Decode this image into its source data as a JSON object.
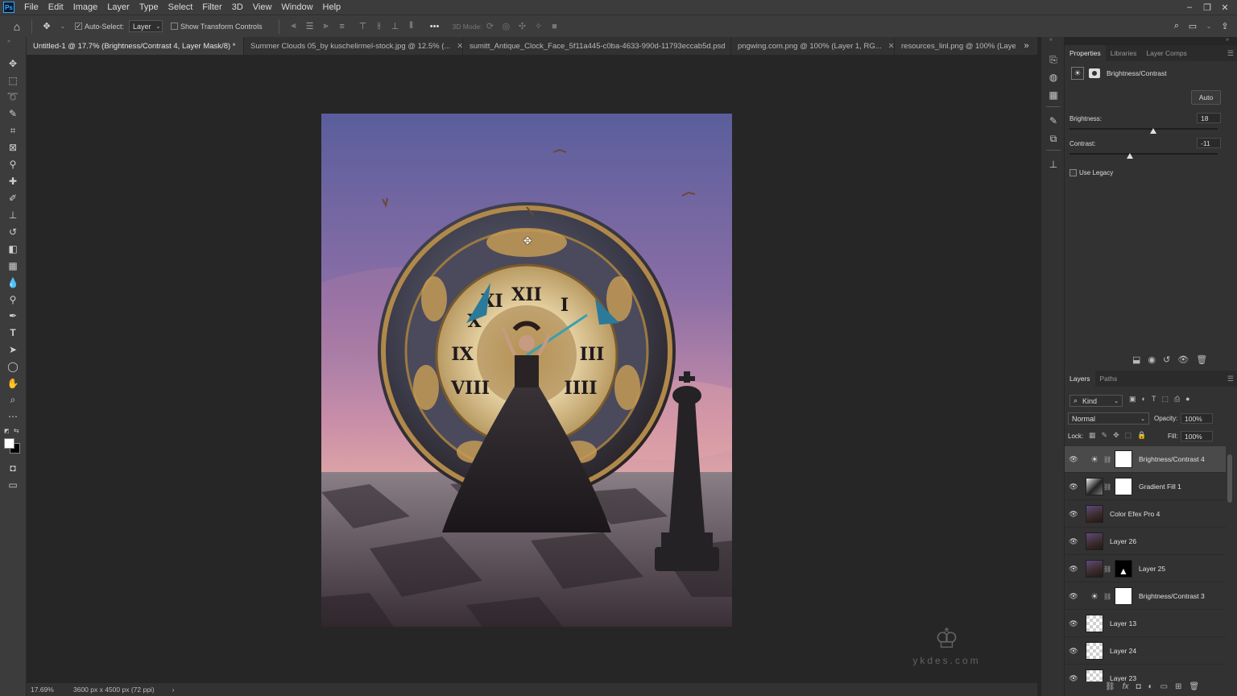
{
  "app": {
    "logo": "Ps"
  },
  "menu": [
    "File",
    "Edit",
    "Image",
    "Layer",
    "Type",
    "Select",
    "Filter",
    "3D",
    "View",
    "Window",
    "Help"
  ],
  "window_controls": {
    "minimize": "–",
    "restore": "❐",
    "close": "✕"
  },
  "options": {
    "auto_select_label": "Auto-Select:",
    "auto_select_value": "Layer",
    "show_transform_label": "Show Transform Controls",
    "three_d_mode": "3D Mode:",
    "more": "•••"
  },
  "tabs": [
    {
      "label": "Untitled-1 @ 17.7% (Brightness/Contrast 4, Layer Mask/8) *",
      "active": true
    },
    {
      "label": "Summer Clouds 05_by kuschelirmel-stock.jpg @ 12.5% (...",
      "active": false
    },
    {
      "label": "sumitt_Antique_Clock_Face_5f11a445-c0ba-4633-990d-11793eccab5d.psd",
      "active": false
    },
    {
      "label": "pngwing.com.png @ 100% (Layer 1, RG...",
      "active": false
    },
    {
      "label": "resources_linl.png @ 100% (Laye",
      "active": false
    }
  ],
  "tab_overflow": "»",
  "status": {
    "zoom": "17.69%",
    "doc_size": "3600 px x 4500 px (72 ppi)",
    "arrow": "›"
  },
  "watermark": {
    "mark": "♔",
    "text": "ykdes.com"
  },
  "properties": {
    "tabs": [
      "Properties",
      "Libraries",
      "Layer Comps"
    ],
    "adjustment_name": "Brightness/Contrast",
    "auto_label": "Auto",
    "brightness_label": "Brightness:",
    "brightness_value": "18",
    "contrast_label": "Contrast:",
    "contrast_value": "-11",
    "legacy_label": "Use Legacy"
  },
  "layers_panel": {
    "tabs": [
      "Layers",
      "Paths"
    ],
    "kind_label": "Kind",
    "blend_mode": "Normal",
    "opacity_label": "Opacity:",
    "opacity_value": "100%",
    "lock_label": "Lock:",
    "fill_label": "Fill:",
    "fill_value": "100%",
    "layers": [
      {
        "name": "Brightness/Contrast 4",
        "thumb": "adj",
        "mask": "white",
        "selected": true
      },
      {
        "name": "Gradient Fill 1",
        "thumb": "grad",
        "mask": "white",
        "selected": false
      },
      {
        "name": "Color Efex Pro 4",
        "thumb": "img",
        "mask": "",
        "selected": false
      },
      {
        "name": "Layer 26",
        "thumb": "img",
        "mask": "",
        "selected": false
      },
      {
        "name": "Layer 25",
        "thumb": "img",
        "mask": "black",
        "selected": false
      },
      {
        "name": "Brightness/Contrast 3",
        "thumb": "adj",
        "mask": "white",
        "selected": false
      },
      {
        "name": "Layer 13",
        "thumb": "check",
        "mask": "",
        "selected": false
      },
      {
        "name": "Layer 24",
        "thumb": "check",
        "mask": "",
        "selected": false
      },
      {
        "name": "Layer 23",
        "thumb": "check",
        "mask": "",
        "selected": false
      }
    ],
    "footer_icons": [
      "link-icon",
      "fx-icon",
      "mask-icon",
      "adjustment-icon",
      "folder-icon",
      "new-layer-icon",
      "trash-icon"
    ]
  },
  "colors": {
    "accent": "#31a8ff",
    "panel": "#323232",
    "chrome": "#3c3c3c",
    "canvas_bg": "#262626"
  }
}
